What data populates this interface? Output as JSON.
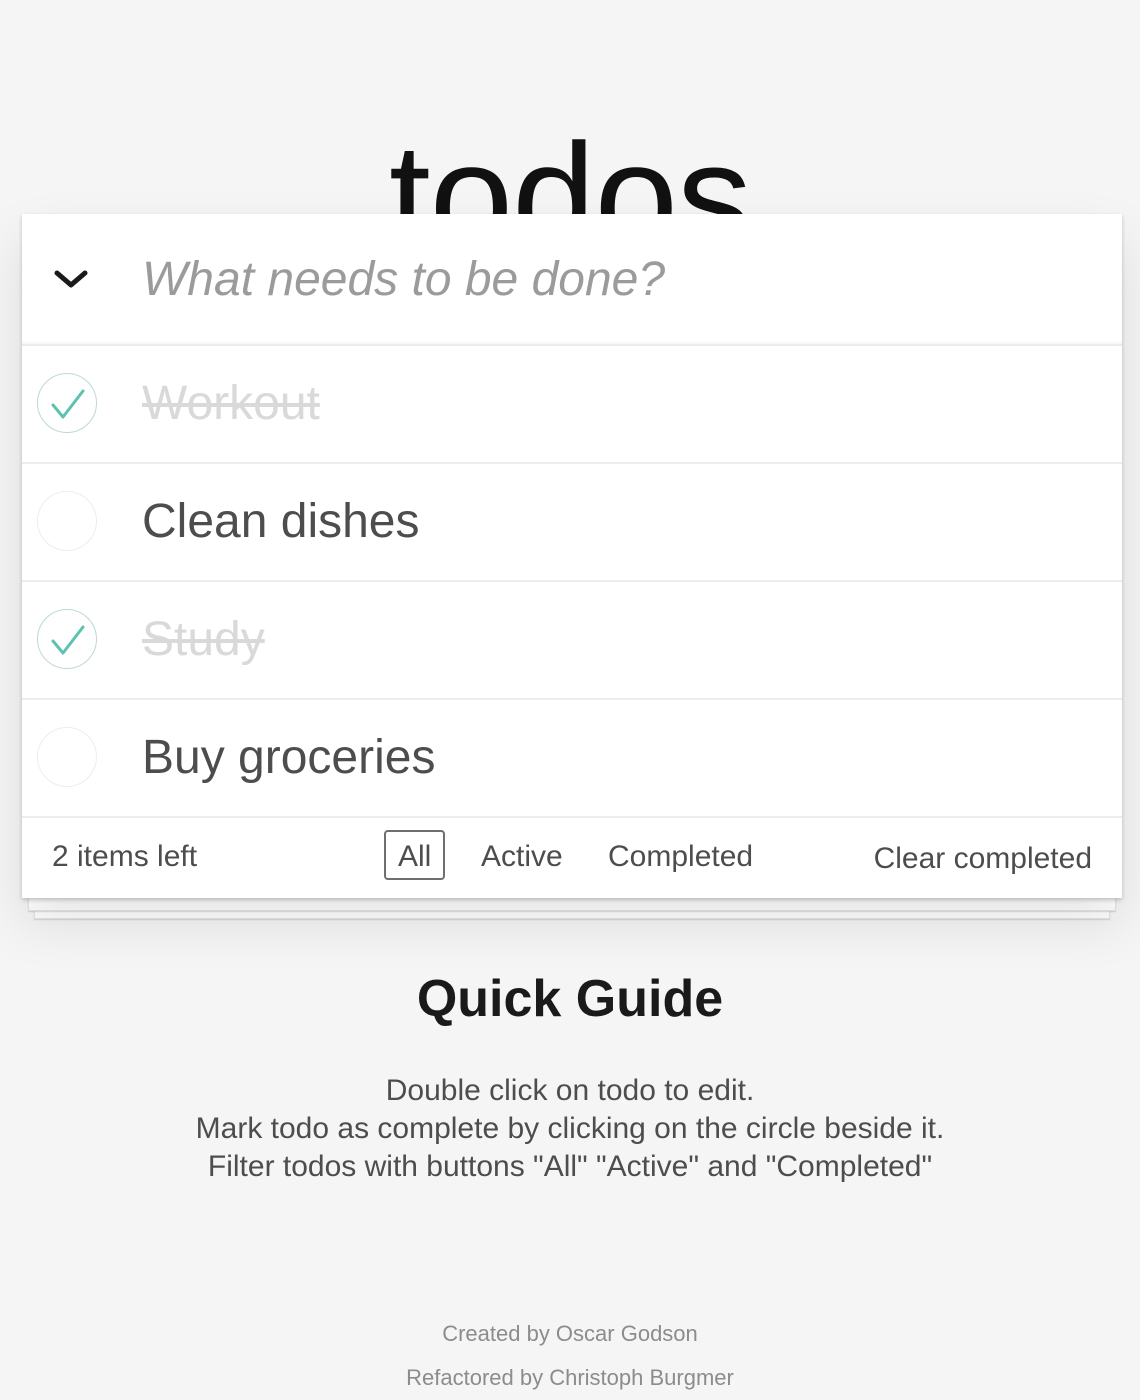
{
  "app": {
    "title": "todos"
  },
  "new_todo": {
    "placeholder": "What needs to be done?",
    "value": ""
  },
  "todos": [
    {
      "label": "Workout",
      "completed": true
    },
    {
      "label": "Clean dishes",
      "completed": false
    },
    {
      "label": "Study",
      "completed": true
    },
    {
      "label": "Buy groceries",
      "completed": false
    }
  ],
  "footer": {
    "count_text": "2 items left",
    "filters": [
      {
        "label": "All",
        "selected": true
      },
      {
        "label": "Active",
        "selected": false
      },
      {
        "label": "Completed",
        "selected": false
      }
    ],
    "clear_completed_label": "Clear completed"
  },
  "guide": {
    "title": "Quick Guide",
    "lines": [
      "Double click on todo to edit.",
      "Mark todo as complete by clicking on the circle beside it.",
      "Filter todos with buttons \"All\" \"Active\" and \"Completed\""
    ]
  },
  "credits": {
    "created_by": "Created by Oscar Godson",
    "refactored_by": "Refactored by Christoph Burgmer"
  },
  "colors": {
    "check_accent": "#5dc2af",
    "check_border": "#bddad5",
    "completed_text": "#d9d9d9",
    "background": "#f5f5f5"
  },
  "icons": {
    "toggle_all": "chevron-down-icon",
    "completed_toggle": "checkmark-icon"
  }
}
